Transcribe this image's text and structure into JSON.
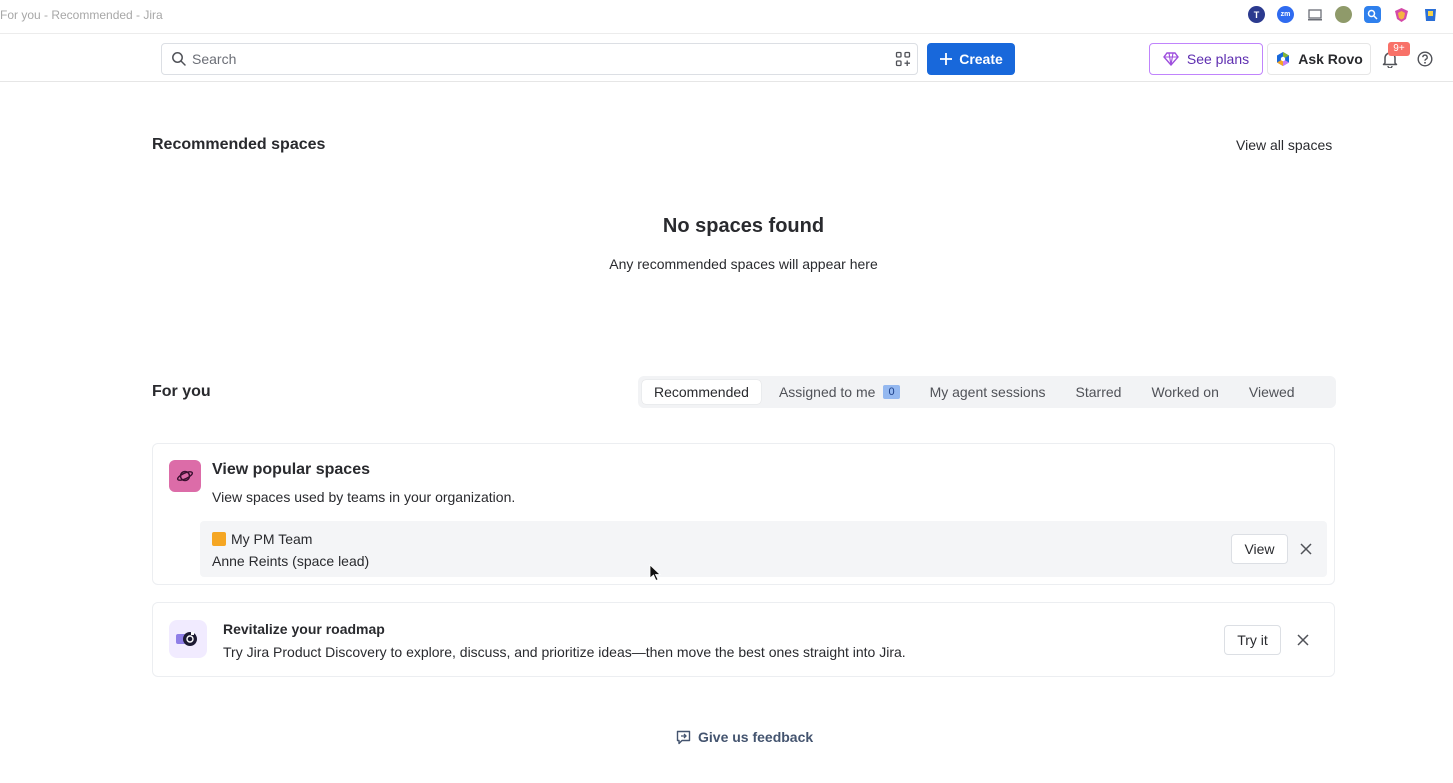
{
  "window": {
    "title": "For you - Recommended - Jira"
  },
  "extensions": [
    {
      "icon": "extension-t-icon",
      "glyph": "T",
      "color": "#2b3a8f"
    },
    {
      "icon": "extension-zm-icon",
      "glyph": "zm",
      "color": "#2f6bf0"
    },
    {
      "icon": "extension-screen-icon",
      "glyph": "",
      "color": "#9aa0a6"
    },
    {
      "icon": "extension-globe-icon",
      "glyph": "",
      "color": "#7f8c5a"
    },
    {
      "icon": "extension-search-icon",
      "glyph": "",
      "color": "#2f80ed"
    },
    {
      "icon": "extension-shield-icon",
      "glyph": "",
      "color": "#d44aa8"
    },
    {
      "icon": "extension-bucket-icon",
      "glyph": "",
      "color": "#2b6fd6"
    }
  ],
  "topnav": {
    "search_placeholder": "Search",
    "create_label": "Create",
    "plans_label": "See plans",
    "rovo_label": "Ask Rovo",
    "notification_count": "9+"
  },
  "recommended": {
    "title": "Recommended spaces",
    "view_all": "View all spaces",
    "empty_title": "No spaces found",
    "empty_subtitle": "Any recommended spaces will appear here"
  },
  "for_you": {
    "title": "For you",
    "tabs": [
      {
        "label": "Recommended",
        "active": true
      },
      {
        "label": "Assigned to me",
        "count": "0"
      },
      {
        "label": "My agent sessions"
      },
      {
        "label": "Starred"
      },
      {
        "label": "Worked on"
      },
      {
        "label": "Viewed"
      }
    ]
  },
  "popular_card": {
    "title": "View popular spaces",
    "description": "View spaces used by teams in your organization.",
    "space": {
      "name": "My PM Team",
      "lead": "Anne Reints (space lead)",
      "view_label": "View"
    }
  },
  "roadmap_card": {
    "title": "Revitalize your roadmap",
    "description": "Try Jira Product Discovery to explore, discuss, and prioritize ideas—then move the best ones straight into Jira.",
    "try_label": "Try it"
  },
  "footer": {
    "feedback_label": "Give us feedback"
  },
  "colors": {
    "primary": "#1868db",
    "plans_border": "#c084fc",
    "badge": "#f87168",
    "space_icon": "#dc6ca8"
  }
}
